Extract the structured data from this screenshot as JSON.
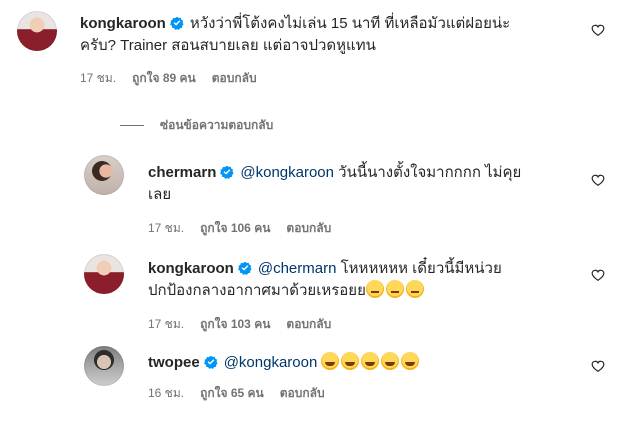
{
  "comments": [
    {
      "username": "kongkaroon",
      "text": "หวังว่าพี่โต้งคงไม่เล่น 15 นาที ที่เหลือมัวแต่ฝอยน่ะครับ? Trainer สอนสบายเลย แต่อาจปวดหูแทน",
      "text_line1": "หวังว่าพี่โต้งคงไม่เล่น 15 นาที ที่เหลือมัวแต่ฝอยน่ะ",
      "text_line2": "ครับ? Trainer สอนสบายเลย แต่อาจปวดหูแทน",
      "time": "17 ชม.",
      "likes": "ถูกใจ 89 คน",
      "reply": "ตอบกลับ"
    },
    {
      "username": "chermarn",
      "mention": "@kongkaroon",
      "text_line1": "วันนี้นางตั้งใจมากกกก ไม่คุย",
      "text_line2": "เลย",
      "time": "17 ชม.",
      "likes": "ถูกใจ 106 คน",
      "reply": "ตอบกลับ"
    },
    {
      "username": "kongkaroon",
      "mention": "@chermarn",
      "text_line1": "โหหหหหห เดี๋ยวนี้มีหน่วย",
      "text_line2": "ปกป้องกลางอากาศมาด้วยเหรอยย",
      "time": "17 ชม.",
      "likes": "ถูกใจ 103 คน",
      "reply": "ตอบกลับ"
    },
    {
      "username": "twopee",
      "mention": "@kongkaroon",
      "time": "16 ชม.",
      "likes": "ถูกใจ 65 คน",
      "reply": "ตอบกลับ"
    }
  ],
  "hide_replies_label": "ซ่อนข้อความตอบกลับ",
  "colors": {
    "text": "#262626",
    "meta": "#737373",
    "mention": "#00376b",
    "verified": "#0095f6"
  }
}
